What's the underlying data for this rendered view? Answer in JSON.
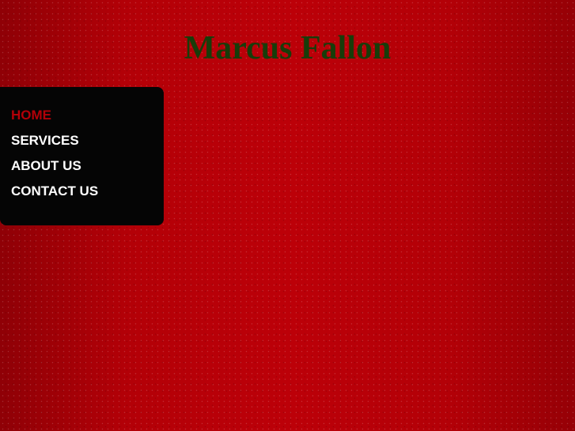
{
  "header": {
    "title": "Marcus Fallon"
  },
  "nav": {
    "items": [
      {
        "label": "HOME",
        "active": true
      },
      {
        "label": "SERVICES",
        "active": false
      },
      {
        "label": "ABOUT US",
        "active": false
      },
      {
        "label": "CONTACT US",
        "active": false
      }
    ],
    "active_color": "#b30008"
  },
  "colors": {
    "background": "#bc0008",
    "title": "#173d0a",
    "nav_background": "#050505",
    "nav_text": "#ffffff"
  }
}
